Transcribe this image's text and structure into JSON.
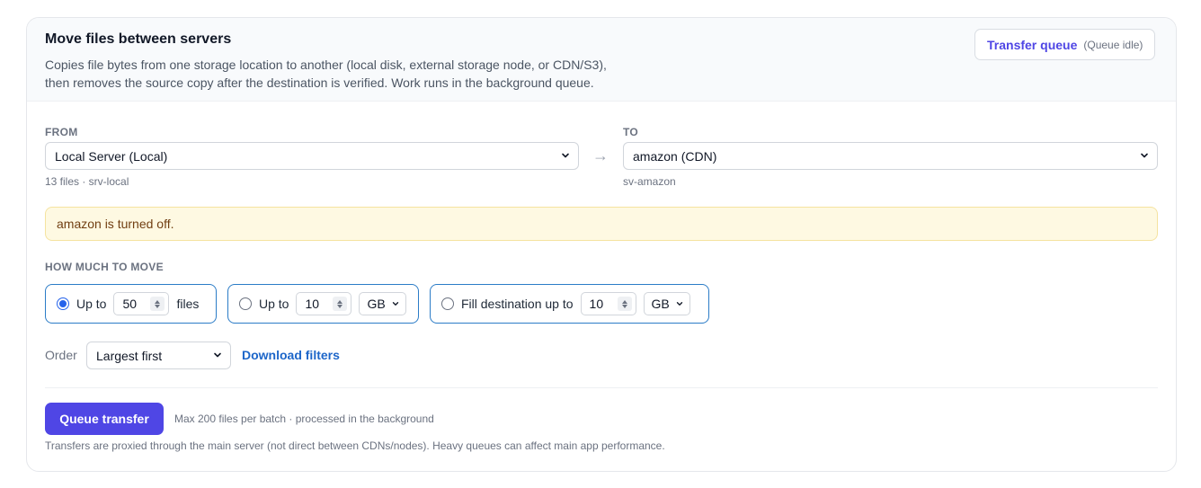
{
  "header": {
    "title": "Move files between servers",
    "desc_line1": "Copies file bytes from one storage location to another (local disk, external storage node, or CDN/S3),",
    "desc_line2": "then removes the source copy after the destination is verified. Work runs in the background queue.",
    "queue_button": {
      "label": "Transfer queue",
      "status": "(Queue idle)"
    }
  },
  "from": {
    "label": "FROM",
    "selected": "Local Server (Local)",
    "sub": "13 files · srv-local"
  },
  "arrow": "→",
  "to": {
    "label": "TO",
    "selected": "amazon (CDN)",
    "sub": "sv-amazon"
  },
  "alert": {
    "text": "amazon is turned off."
  },
  "amount": {
    "label": "HOW MUCH TO MOVE",
    "options": [
      {
        "prefix": "Up to",
        "value": "50",
        "suffix": "files",
        "selected": true
      },
      {
        "prefix": "Up to",
        "value": "10",
        "unit": "GB",
        "selected": false
      },
      {
        "prefix": "Fill destination up to",
        "value": "10",
        "unit": "GB",
        "selected": false
      }
    ]
  },
  "order": {
    "label": "Order",
    "selected": "Largest first",
    "link": "Download filters"
  },
  "footer": {
    "button": "Queue transfer",
    "hint": "Max 200 files per batch · processed in the background",
    "note": "Transfers are proxied through the main server (not direct between CDNs/nodes). Heavy queues can affect main app performance."
  },
  "colors": {
    "accent": "#4f46e5",
    "link": "#1d66c9",
    "option_border": "#2b7cc7",
    "alert_bg": "#fef9e2"
  }
}
